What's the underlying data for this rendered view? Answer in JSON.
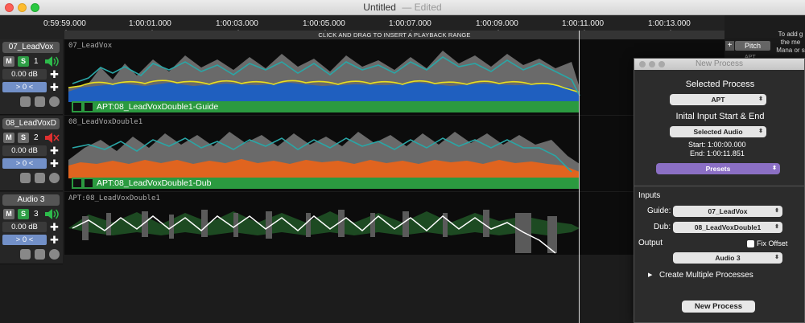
{
  "window": {
    "title": "Untitled",
    "status": "— Edited"
  },
  "ruler": {
    "labels": [
      "0:59:59.000",
      "1:00:01.000",
      "1:00:03.000",
      "1:00:05.000",
      "1:00:07.000",
      "1:00:09.000",
      "1:00:11.000",
      "1:00:13.000"
    ],
    "hint": "CLICK AND DRAG TO INSERT A PLAYBACK RANGE"
  },
  "tracks": [
    {
      "name": "07_LeadVox",
      "mute": "M",
      "solo": "S",
      "number": "1",
      "volume": "0.00 dB",
      "pan": "> 0 <",
      "lane_label": "07_LeadVox",
      "clip_label": "APT:08_LeadVoxDouble1-Guide",
      "speaker": "on"
    },
    {
      "name": "08_LeadVoxD",
      "mute": "M",
      "solo": "S",
      "number": "2",
      "volume": "0.00 dB",
      "pan": "> 0 <",
      "lane_label": "08_LeadVoxDouble1",
      "clip_label": "APT:08_LeadVoxDouble1-Dub",
      "speaker": "muted"
    },
    {
      "name": "Audio 3",
      "mute": "M",
      "solo": "S",
      "number": "3",
      "volume": "0.00 dB",
      "pan": "> 0 <",
      "lane_label": "APT:08_LeadVoxDouble1",
      "clip_label": "",
      "speaker": "on"
    }
  ],
  "right_strip": {
    "pitch_label": "Pitch",
    "mini_label": "APT",
    "help_text": "To add g the me Mana or s"
  },
  "dialog": {
    "title": "New Process",
    "selected_process_heading": "Selected Process",
    "process_value": "APT",
    "initial_range_heading": "Inital Input Start & End",
    "range_value": "Selected Audio",
    "start_text": "Start: 1:00:00.000",
    "end_text": "End: 1:00:11.851",
    "presets_label": "Presets",
    "inputs_label": "Inputs",
    "guide_label": "Guide:",
    "guide_value": "07_LeadVox",
    "dub_label": "Dub:",
    "dub_value": "08_LeadVoxDouble1",
    "output_label": "Output",
    "fix_offset_label": "Fix Offset",
    "output_value": "Audio 3",
    "create_multiple_label": "Create Multiple Processes",
    "new_process_button": "New Process"
  },
  "colors": {
    "track1_fill": "#1f5fbf",
    "track1_line": "#e8e020",
    "track2_fill": "#e0641f",
    "pitch_line": "#2aa6a6",
    "clip_bar": "#2b9a40",
    "solo_active": "#2d9d45",
    "speaker_on": "#2dbb4b",
    "speaker_muted": "#e03030",
    "presets_purple": "#8b6fc4"
  }
}
